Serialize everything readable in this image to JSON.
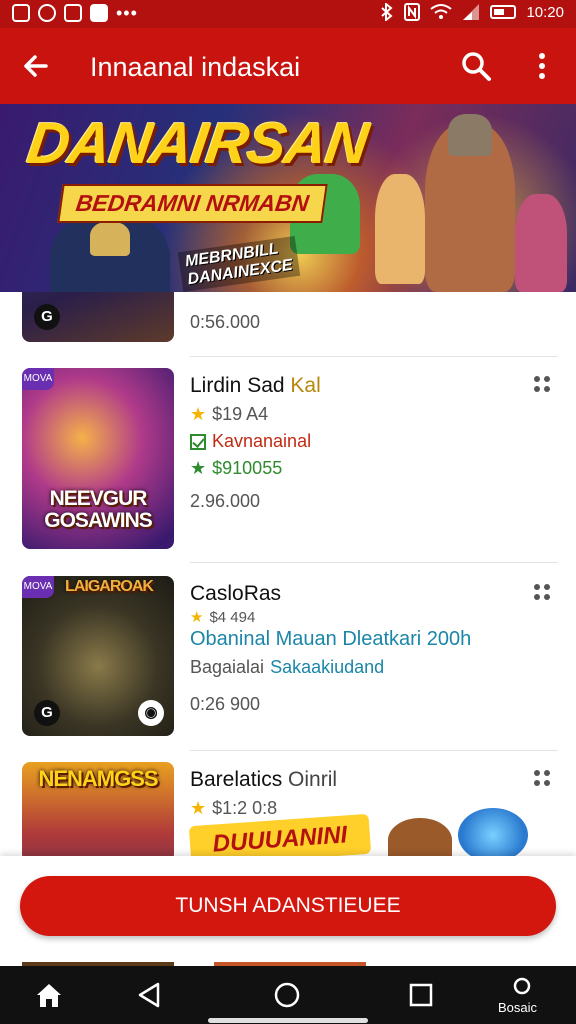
{
  "status_bar": {
    "time": "10:20",
    "left_icons": [
      "app-icon",
      "circle-icon",
      "square-icon",
      "map-icon"
    ],
    "right_icons": [
      "bluetooth-icon",
      "nfc-icon",
      "wifi-icon",
      "signal-icon",
      "battery-icon"
    ]
  },
  "app_bar": {
    "title": "Innaanal indaskai"
  },
  "banner": {
    "headline": "DANAIRSAN",
    "subline": "BEDRAMNI NRMABN",
    "tag_line1": "MEBRNBILL",
    "tag_line2": "DANAINEXCE"
  },
  "items": [
    {
      "badge": "G",
      "price": "0:56.000"
    },
    {
      "corner": "MOVA",
      "thumb_title": "NEEVGUR GOSAWINS",
      "name": "Lirdin Sad",
      "name_suffix": "Kal",
      "rating": "$19 A4",
      "tag": "Kavnanainal",
      "extra": "$910055",
      "price": "2.96.000"
    },
    {
      "corner": "MOVA",
      "thumb_title": "LAIGAROAK",
      "badge": "G",
      "name": "CasloRas",
      "rating": "$4 494",
      "desc": "Obaninal Mauan Dleatkari 200h",
      "sub_prefix": "Bagaialai",
      "sub_link": "Sakaakiudand",
      "price": "0:26 900"
    },
    {
      "thumb_title": "NENAMGSS",
      "name": "Barelatics",
      "name_suffix": "Oinril",
      "rating": "$1:2 0:8",
      "promo_text": "DUUUANINI"
    }
  ],
  "cta": {
    "label": "TUNSH ADANSTIEUEE"
  },
  "nav": {
    "label": "Bosaic"
  },
  "colors": {
    "primary": "#c8130f",
    "status_bar": "#b3110f",
    "accent_green": "#2e8b2e",
    "accent_teal": "#1b86a8",
    "star": "#f4b400"
  }
}
